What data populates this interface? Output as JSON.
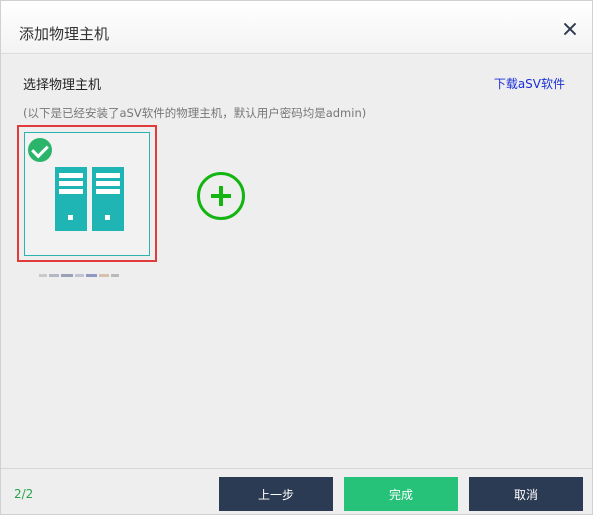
{
  "dialog": {
    "title": "添加物理主机",
    "close_icon": "close-icon"
  },
  "content": {
    "section_title": "选择物理主机",
    "download_link": "下载aSV软件",
    "hint": "(以下是已经安装了aSV软件的物理主机，默认用户密码均是admin)",
    "hosts": [
      {
        "selected": true,
        "icon": "server-rack-icon",
        "name": ""
      }
    ],
    "add_icon": "add-circle-icon"
  },
  "footer": {
    "step": "2/2",
    "prev_label": "上一步",
    "done_label": "完成",
    "cancel_label": "取消"
  },
  "colors": {
    "accent_green": "#27c27a",
    "dark_button": "#2b3b53",
    "server_teal": "#1fb5b5",
    "selection_red": "#e23b3b",
    "link_blue": "#1a2fd6"
  }
}
